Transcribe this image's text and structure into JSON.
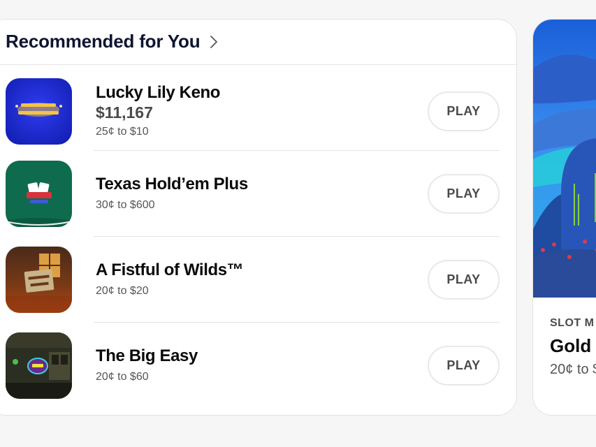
{
  "section": {
    "title": "Recommended for You",
    "icon": "chevron-right-icon"
  },
  "games": [
    {
      "name": "Lucky Lily Keno",
      "jackpot": "$11,167",
      "range": "25¢ to $10",
      "play_label": "PLAY",
      "thumb_color": "#1a2bd0"
    },
    {
      "name": "Texas Hold’em Plus",
      "jackpot": "",
      "range": "30¢ to $600",
      "play_label": "PLAY",
      "thumb_color": "#0f6b4e"
    },
    {
      "name": "A Fistful of Wilds™",
      "jackpot": "",
      "range": "20¢ to $20",
      "play_label": "PLAY",
      "thumb_color": "#6b3418"
    },
    {
      "name": "The Big Easy",
      "jackpot": "",
      "range": "20¢ to $60",
      "play_label": "PLAY",
      "thumb_color": "#2b2f22"
    }
  ],
  "side_card": {
    "category": "SLOT M",
    "title": "Gold",
    "range": "20¢ to $"
  }
}
